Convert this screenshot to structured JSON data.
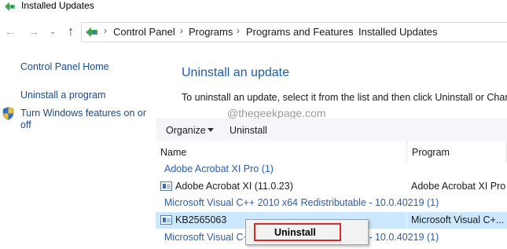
{
  "window": {
    "title": "Installed Updates"
  },
  "nav": {
    "back_icon": "arrow-left-icon",
    "forward_icon": "arrow-right-icon",
    "history_icon": "chevron-down-icon",
    "up_icon": "arrow-up-icon",
    "breadcrumbs": [
      "Control Panel",
      "Programs",
      "Programs and Features",
      "Installed Updates"
    ]
  },
  "left_pane": {
    "links": [
      "Control Panel Home",
      "Uninstall a program",
      "Turn Windows features on or",
      "off"
    ]
  },
  "main": {
    "title": "Uninstall an update",
    "description": "To uninstall an update, select it from the list and then click Uninstall or Change.",
    "watermark": "@thegeekpage.com"
  },
  "toolbar": {
    "organize_label": "Organize",
    "uninstall_label": "Uninstall"
  },
  "columns": [
    "Name",
    "Program"
  ],
  "list": {
    "groups": [
      {
        "header": "Adobe Acrobat XI Pro (1)",
        "rows": [
          {
            "name": "Adobe Acrobat XI (11.0.23)",
            "program": "Adobe Acrobat XI Pro",
            "selected": false
          }
        ]
      },
      {
        "header": "Microsoft Visual C++ 2010  x64 Redistributable - 10.0.40219 (1)",
        "rows": [
          {
            "name": "KB2565063",
            "program": "Microsoft Visual C+...",
            "selected": true
          }
        ]
      },
      {
        "header": "Microsoft Visual C++ 2010  x86 Redistributable - 10.0.40219 (1)",
        "rows": []
      }
    ]
  },
  "context_menu": {
    "items": [
      "Uninstall"
    ],
    "highlight_color": "#d42a2a"
  },
  "colors": {
    "link": "#1a4a8a",
    "heading": "#1e5ba8",
    "group_header": "#2b5ea8",
    "selection": "#cce8ff",
    "toolbar_bg": "#f4f6f9"
  }
}
